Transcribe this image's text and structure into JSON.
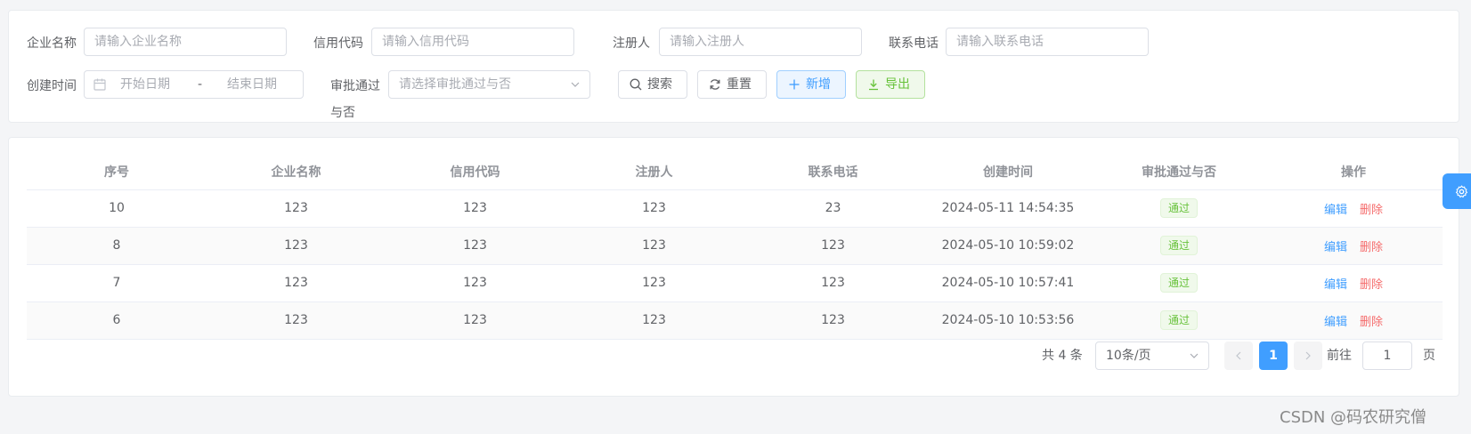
{
  "search": {
    "company_name_label": "企业名称",
    "company_name_placeholder": "请输入企业名称",
    "credit_code_label": "信用代码",
    "credit_code_placeholder": "请输入信用代码",
    "registrant_label": "注册人",
    "registrant_placeholder": "请输入注册人",
    "phone_label": "联系电话",
    "phone_placeholder": "请输入联系电话",
    "created_time_label": "创建时间",
    "start_date_placeholder": "开始日期",
    "range_separator": "-",
    "end_date_placeholder": "结束日期",
    "approval_label_line1": "审批通过",
    "approval_label_line2": "与否",
    "approval_placeholder": "请选择审批通过与否",
    "search_button": "搜索",
    "reset_button": "重置",
    "add_button": "新增",
    "export_button": "导出"
  },
  "table": {
    "headers": [
      "序号",
      "企业名称",
      "信用代码",
      "注册人",
      "联系电话",
      "创建时间",
      "审批通过与否",
      "操作"
    ],
    "rows": [
      {
        "index": "10",
        "company": "123",
        "credit": "123",
        "registrant": "123",
        "phone": "23",
        "created": "2024-05-11 14:54:35",
        "approval": "通过"
      },
      {
        "index": "8",
        "company": "123",
        "credit": "123",
        "registrant": "123",
        "phone": "123",
        "created": "2024-05-10 10:59:02",
        "approval": "通过"
      },
      {
        "index": "7",
        "company": "123",
        "credit": "123",
        "registrant": "123",
        "phone": "123",
        "created": "2024-05-10 10:57:41",
        "approval": "通过"
      },
      {
        "index": "6",
        "company": "123",
        "credit": "123",
        "registrant": "123",
        "phone": "123",
        "created": "2024-05-10 10:53:56",
        "approval": "通过"
      }
    ],
    "edit_label": "编辑",
    "delete_label": "删除"
  },
  "pagination": {
    "total_text": "共 4 条",
    "page_size": "10条/页",
    "current_page": "1",
    "goto_label": "前往",
    "jump_value": "1",
    "page_suffix": "页"
  },
  "watermark": "CSDN @码农研究僧",
  "colors": {
    "primary": "#409eff",
    "success": "#67c23a",
    "danger": "#f56c6c"
  },
  "icons": {
    "calendar": "calendar-icon",
    "select_arrow": "chevron-down-icon",
    "search": "search-icon",
    "reset": "refresh-icon",
    "add": "plus-icon",
    "export": "download-icon",
    "prev": "chevron-left-icon",
    "next": "chevron-right-icon",
    "settings": "gear-icon"
  }
}
